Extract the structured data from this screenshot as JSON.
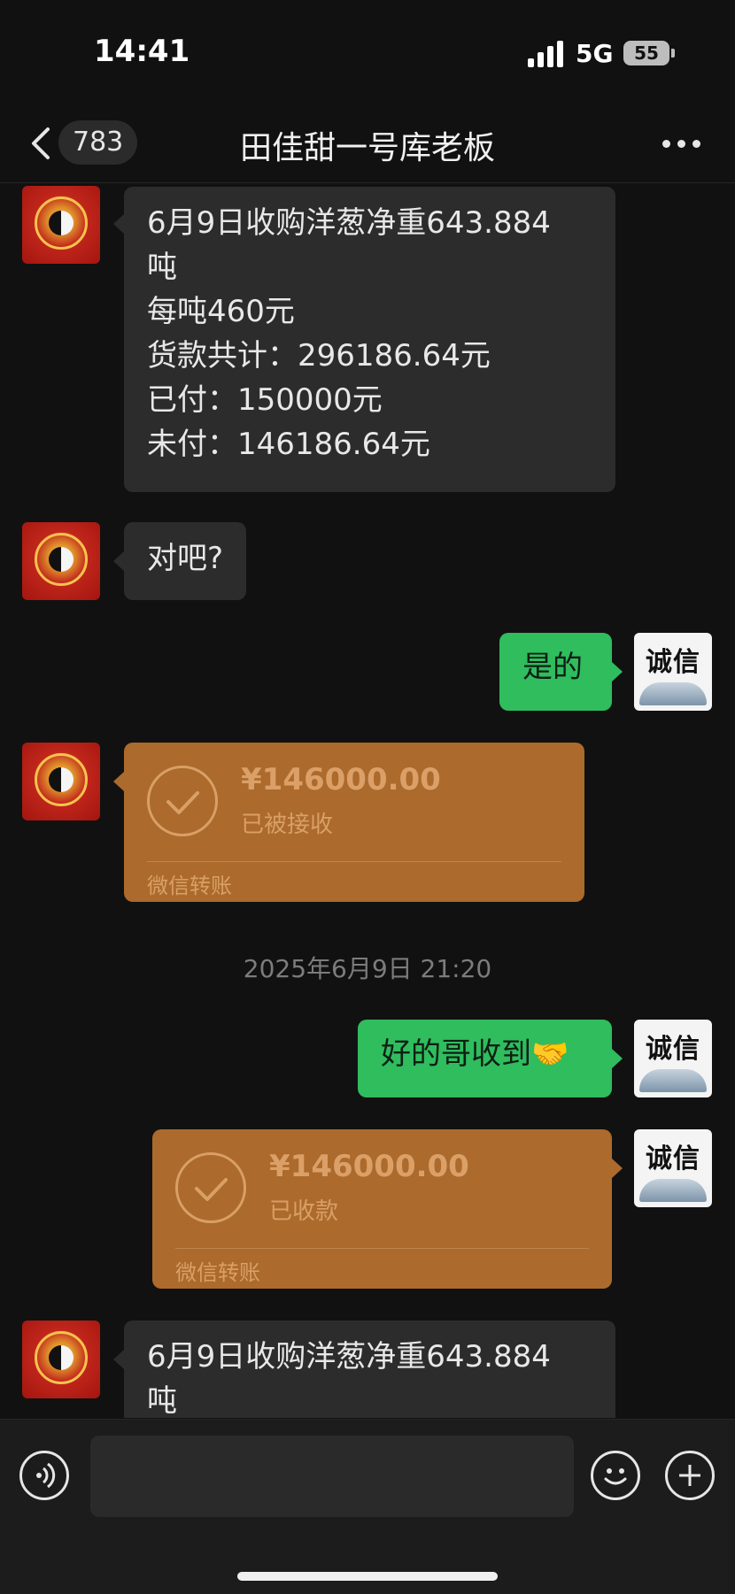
{
  "status_bar": {
    "time": "14:41",
    "network": "5G",
    "battery": "55"
  },
  "header": {
    "unread_count": "783",
    "title": "田佳甜一号库老板"
  },
  "messages": {
    "m1": {
      "lines": [
        "6月9日收购洋葱净重643.884",
        "吨",
        "每吨460元",
        "货款共计：296186.64元",
        "已付：150000元",
        "未付：146186.64元"
      ]
    },
    "m2": {
      "text": "对吧?"
    },
    "m3": {
      "text": "是的"
    },
    "m4": {
      "amount": "¥146000.00",
      "status": "已被接收",
      "label": "微信转账"
    },
    "timestamp": "2025年6月9日 21:20",
    "m5": {
      "text": "好的哥收到🤝"
    },
    "m6": {
      "amount": "¥146000.00",
      "status": "已收款",
      "label": "微信转账"
    },
    "m7": {
      "lines": [
        "6月9日收购洋葱净重643.884",
        "吨"
      ]
    }
  },
  "avatars": {
    "self_text": "诚信"
  },
  "input": {
    "placeholder": ""
  }
}
